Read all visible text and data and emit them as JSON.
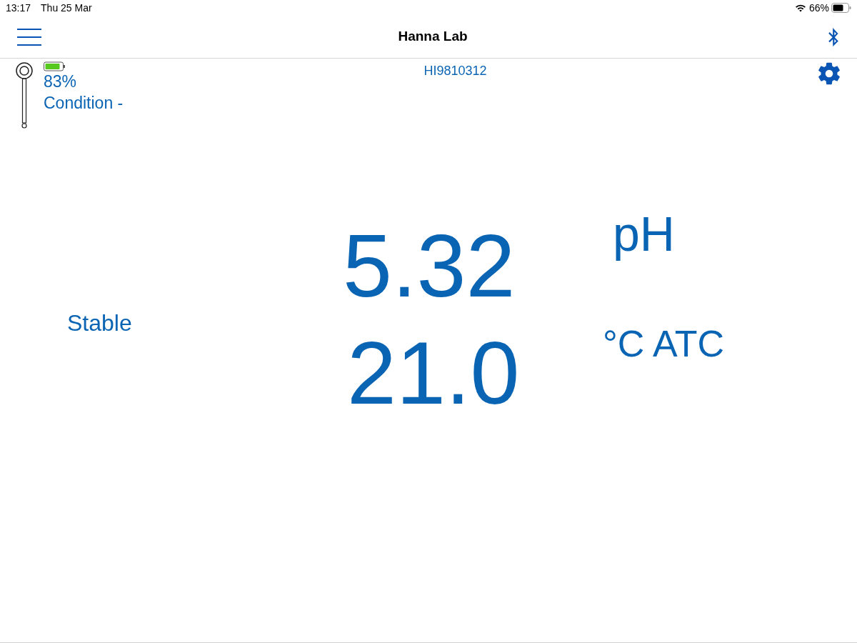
{
  "status_bar": {
    "time": "13:17",
    "date": "Thu 25 Mar",
    "battery": "66%"
  },
  "nav_bar": {
    "title": "Hanna Lab"
  },
  "probe": {
    "battery": "83%",
    "condition": "Condition -"
  },
  "device": {
    "serial": "HI9810312"
  },
  "stability": "Stable",
  "readings": [
    {
      "value": "5.32",
      "unit": "pH"
    },
    {
      "value": "21.0",
      "unit": "°C ATC"
    }
  ]
}
